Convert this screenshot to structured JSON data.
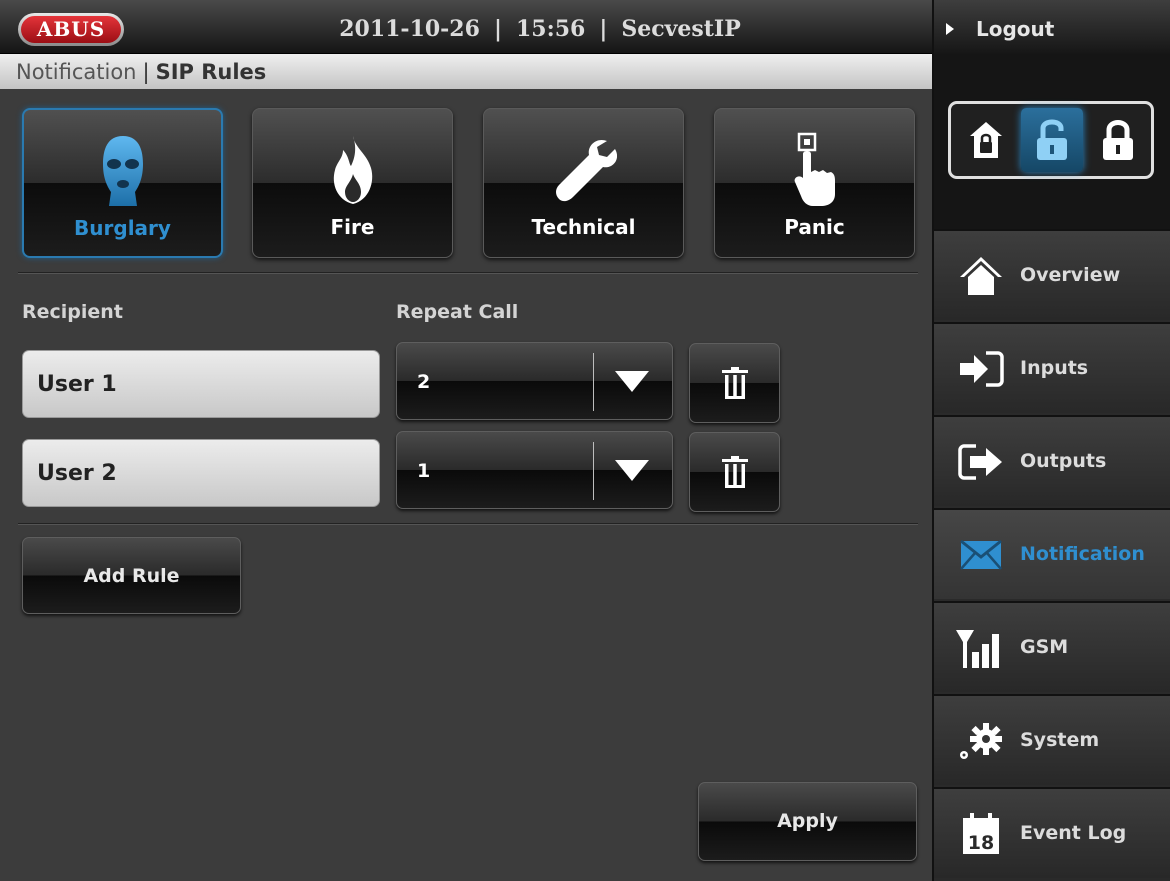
{
  "header": {
    "logo_text": "ABUS",
    "date": "2011-10-26",
    "time": "15:56",
    "device": "SecvestIP",
    "separator": "|"
  },
  "breadcrumb": {
    "section": "Notification",
    "separator": "|",
    "page": "SIP Rules"
  },
  "categories": [
    {
      "label": "Burglary",
      "icon": "burglar-mask-icon",
      "active": true
    },
    {
      "label": "Fire",
      "icon": "flame-icon",
      "active": false
    },
    {
      "label": "Technical",
      "icon": "wrench-icon",
      "active": false
    },
    {
      "label": "Panic",
      "icon": "hand-press-icon",
      "active": false
    }
  ],
  "columns": {
    "recipient": "Recipient",
    "repeat_call": "Repeat Call"
  },
  "rules": [
    {
      "recipient": "User 1",
      "repeat_call": "2"
    },
    {
      "recipient": "User 2",
      "repeat_call": "1"
    }
  ],
  "buttons": {
    "add_rule": "Add Rule",
    "apply": "Apply"
  },
  "sidebar": {
    "logout": "Logout",
    "lock_modes": [
      {
        "icon": "house-lock-icon",
        "active": false
      },
      {
        "icon": "unlocked-icon",
        "active": true
      },
      {
        "icon": "locked-icon",
        "active": false
      }
    ],
    "nav": [
      {
        "label": "Overview",
        "icon": "home-icon",
        "active": false
      },
      {
        "label": "Inputs",
        "icon": "input-arrow-icon",
        "active": false
      },
      {
        "label": "Outputs",
        "icon": "output-arrow-icon",
        "active": false
      },
      {
        "label": "Notification",
        "icon": "envelope-icon",
        "active": true
      },
      {
        "label": "GSM",
        "icon": "signal-bars-icon",
        "active": false
      },
      {
        "label": "System",
        "icon": "gears-icon",
        "active": false
      },
      {
        "label": "Event Log",
        "icon": "calendar-icon",
        "active": false
      }
    ],
    "event_log_day": "18"
  },
  "colors": {
    "accent": "#2f8fd0",
    "logo_red": "#d3262c",
    "panel": "#3c3c3c"
  }
}
